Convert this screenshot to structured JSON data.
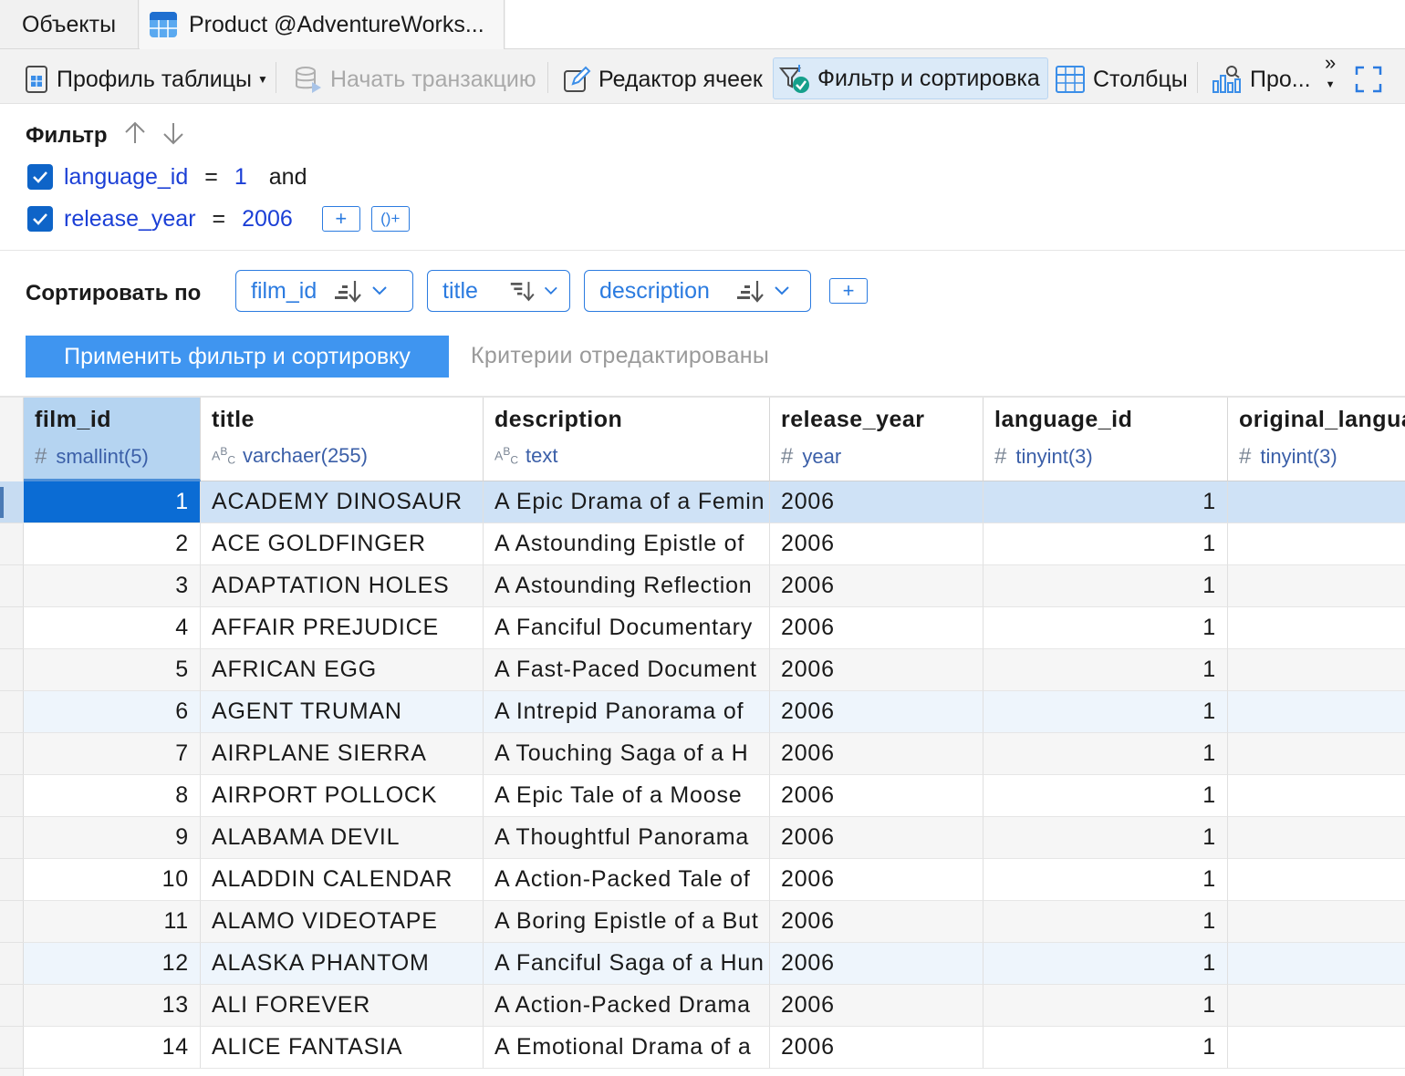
{
  "tabs": {
    "objects": "Объекты",
    "product": "Product @AdventureWorks..."
  },
  "toolbar": {
    "table_profile": "Профиль таблицы",
    "begin_transaction": "Начать транзакцию",
    "cell_editor": "Редактор ячеек",
    "filter_sort": "Фильтр и сортировка",
    "columns": "Столбцы",
    "profile_short": "Про...",
    "overflow": "»"
  },
  "filter": {
    "title": "Фильтр",
    "conditions": [
      {
        "column": "language_id",
        "operator": "=",
        "value": "1",
        "joiner": "and",
        "checked": true
      },
      {
        "column": "release_year",
        "operator": "=",
        "value": "2006",
        "joiner": "",
        "checked": true
      }
    ],
    "add_label": "+",
    "add_group_label": "()+"
  },
  "sort": {
    "label": "Сортировать по",
    "fields": [
      "film_id",
      "title",
      "description"
    ],
    "add_label": "+",
    "apply_button": "Применить фильтр и сортировку",
    "status": "Критерии отредактированы"
  },
  "grid": {
    "columns": [
      {
        "name": "film_id",
        "type": "smallint(5)",
        "glyph": "#"
      },
      {
        "name": "title",
        "type": "varchaer(255)",
        "glyph": "abc"
      },
      {
        "name": "description",
        "type": "text",
        "glyph": "abc"
      },
      {
        "name": "release_year",
        "type": "year",
        "glyph": "#"
      },
      {
        "name": "language_id",
        "type": "tinyint(3)",
        "glyph": "#"
      },
      {
        "name": "original_langua",
        "type": "tinyint(3)",
        "glyph": "#"
      }
    ],
    "rows": [
      {
        "film_id": "1",
        "title": "ACADEMY DINOSAUR",
        "description": "A Epic Drama of a Femin",
        "release_year": "2006",
        "language_id": "1"
      },
      {
        "film_id": "2",
        "title": "ACE GOLDFINGER",
        "description": "A Astounding Epistle of",
        "release_year": "2006",
        "language_id": "1"
      },
      {
        "film_id": "3",
        "title": "ADAPTATION HOLES",
        "description": "A Astounding Reflection",
        "release_year": "2006",
        "language_id": "1"
      },
      {
        "film_id": "4",
        "title": "AFFAIR PREJUDICE",
        "description": "A Fanciful Documentary",
        "release_year": "2006",
        "language_id": "1"
      },
      {
        "film_id": "5",
        "title": "AFRICAN EGG",
        "description": "A Fast-Paced Document",
        "release_year": "2006",
        "language_id": "1"
      },
      {
        "film_id": "6",
        "title": "AGENT TRUMAN",
        "description": "A Intrepid Panorama of",
        "release_year": "2006",
        "language_id": "1"
      },
      {
        "film_id": "7",
        "title": "AIRPLANE SIERRA",
        "description": "A Touching Saga of a H",
        "release_year": "2006",
        "language_id": "1"
      },
      {
        "film_id": "8",
        "title": "AIRPORT POLLOCK",
        "description": "A Epic Tale of a Moose",
        "release_year": "2006",
        "language_id": "1"
      },
      {
        "film_id": "9",
        "title": "ALABAMA DEVIL",
        "description": "A Thoughtful Panorama",
        "release_year": "2006",
        "language_id": "1"
      },
      {
        "film_id": "10",
        "title": "ALADDIN CALENDAR",
        "description": "A Action-Packed Tale of",
        "release_year": "2006",
        "language_id": "1"
      },
      {
        "film_id": "11",
        "title": "ALAMO VIDEOTAPE",
        "description": "A Boring Epistle of a But",
        "release_year": "2006",
        "language_id": "1"
      },
      {
        "film_id": "12",
        "title": "ALASKA PHANTOM",
        "description": "A Fanciful Saga of a Hun",
        "release_year": "2006",
        "language_id": "1"
      },
      {
        "film_id": "13",
        "title": "ALI FOREVER",
        "description": "A Action-Packed Drama",
        "release_year": "2006",
        "language_id": "1"
      },
      {
        "film_id": "14",
        "title": "ALICE FANTASIA",
        "description": "A Emotional Drama of a",
        "release_year": "2006",
        "language_id": "1"
      }
    ]
  },
  "colors": {
    "accent": "#2b7be0",
    "apply_button": "#3f95f0",
    "selected_cell": "#0b6cd4",
    "selected_row": "#cfe2f6",
    "link_text": "#1b3fd6"
  }
}
